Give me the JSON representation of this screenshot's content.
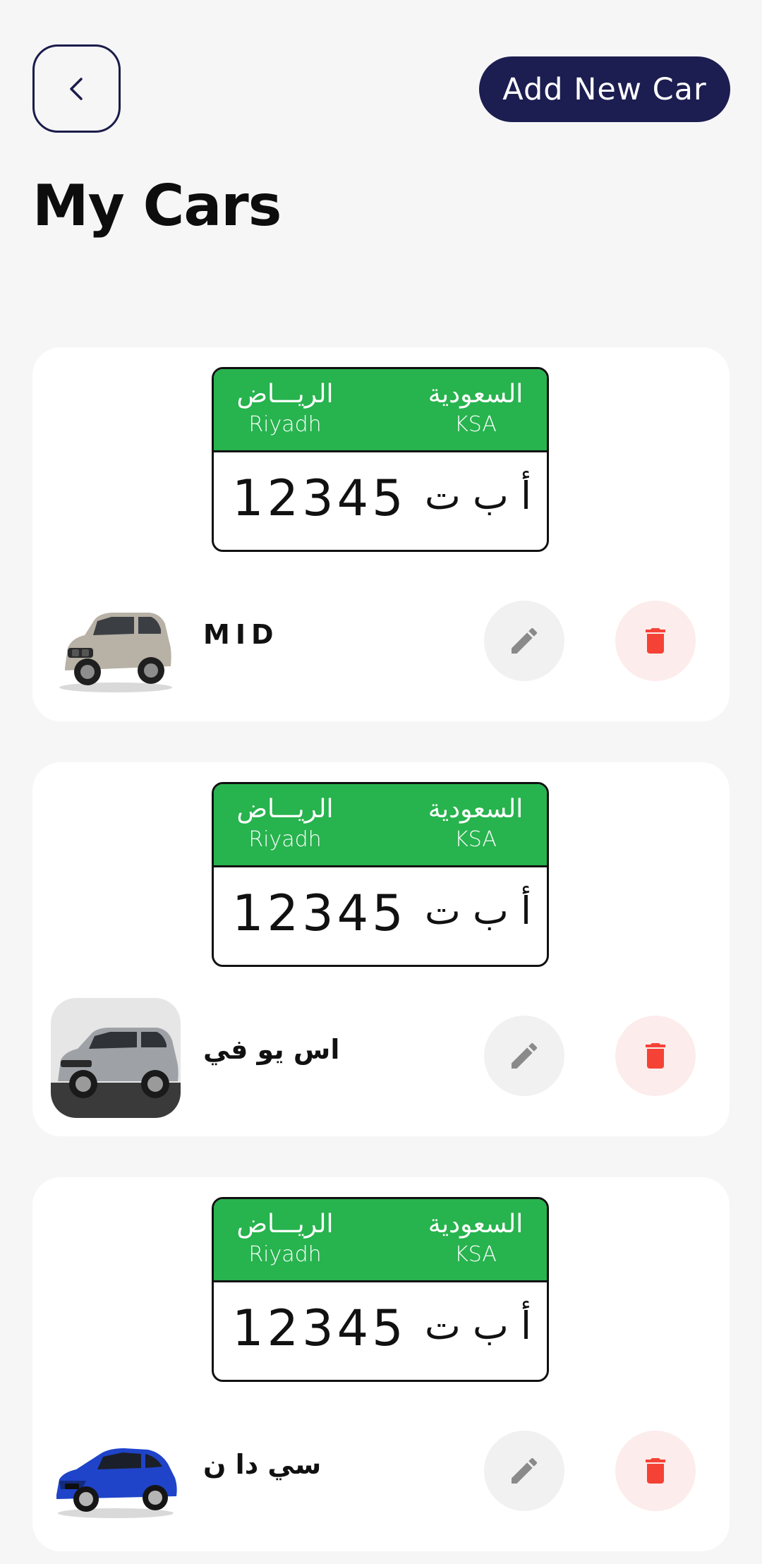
{
  "header": {
    "back_icon": "chevron-left-icon",
    "add_button_label": "Add New Car",
    "title": "My Cars"
  },
  "colors": {
    "primary": "#1c1d50",
    "plate_green": "#27b34e",
    "delete_red": "#f44336",
    "edit_gray": "#8a8a8a",
    "background": "#f6f6f7"
  },
  "cars": [
    {
      "plate": {
        "city_ar": "الريـــاض",
        "city_en": "Riyadh",
        "country_ar": "السعودية",
        "country_en": "KSA",
        "number": "12345",
        "letters": "أ ب ت"
      },
      "name": "MID",
      "thumb_icon": "suv-car-image",
      "edit_icon": "pencil-icon",
      "delete_icon": "trash-icon"
    },
    {
      "plate": {
        "city_ar": "الريـــاض",
        "city_en": "Riyadh",
        "country_ar": "السعودية",
        "country_en": "KSA",
        "number": "12345",
        "letters": "أ ب ت"
      },
      "name": "اس يو في",
      "thumb_icon": "range-rover-image",
      "edit_icon": "pencil-icon",
      "delete_icon": "trash-icon"
    },
    {
      "plate": {
        "city_ar": "الريـــاض",
        "city_en": "Riyadh",
        "country_ar": "السعودية",
        "country_en": "KSA",
        "number": "12345",
        "letters": "أ ب ت"
      },
      "name": "سي دا ن",
      "thumb_icon": "sedan-car-image",
      "edit_icon": "pencil-icon",
      "delete_icon": "trash-icon"
    }
  ]
}
